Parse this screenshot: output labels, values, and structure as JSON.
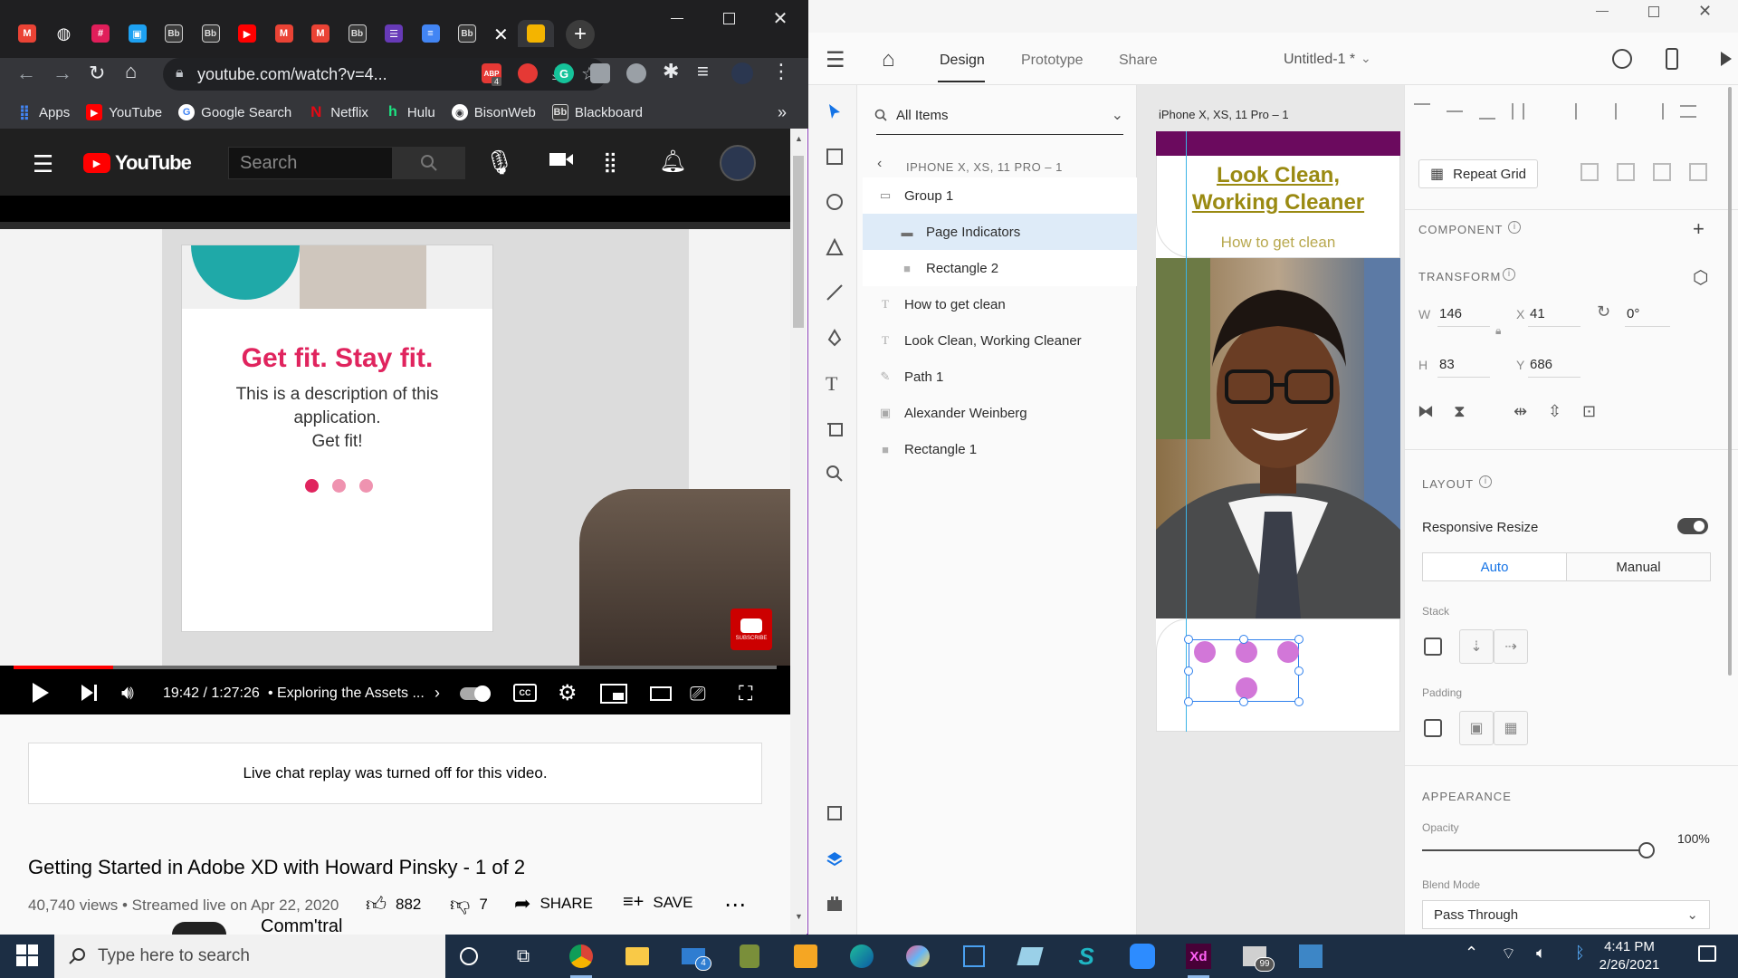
{
  "browser": {
    "tabs": [
      {
        "icon": "gmail-icon",
        "color": "#ea4335"
      },
      {
        "icon": "globe-icon",
        "color": "#ffffff"
      },
      {
        "icon": "slack-icon",
        "color": "#e01e5a"
      },
      {
        "icon": "twitter-icon",
        "color": "#1da1f2"
      },
      {
        "icon": "blackboard-icon",
        "color": "#cfcfcf"
      },
      {
        "icon": "blackboard-icon",
        "color": "#cfcfcf"
      },
      {
        "icon": "youtube-icon",
        "color": "#ff0000"
      },
      {
        "icon": "gmail-icon",
        "color": "#ea4335"
      },
      {
        "icon": "gmail-icon",
        "color": "#ea4335"
      },
      {
        "icon": "blackboard-icon",
        "color": "#cfcfcf"
      },
      {
        "icon": "forms-icon",
        "color": "#673ab7"
      },
      {
        "icon": "docs-icon",
        "color": "#4285f4"
      },
      {
        "icon": "blackboard-icon",
        "color": "#cfcfcf"
      }
    ],
    "active_tab_icon": "slides-icon",
    "url": "youtube.com/watch?v=4...",
    "extension_badge": "4",
    "bookmarks": [
      {
        "label": "Apps",
        "icon": "apps-grid-icon"
      },
      {
        "label": "YouTube",
        "icon": "youtube-icon"
      },
      {
        "label": "Google Search",
        "icon": "google-icon"
      },
      {
        "label": "Netflix",
        "icon": "netflix-icon"
      },
      {
        "label": "Hulu",
        "icon": "hulu-icon"
      },
      {
        "label": "BisonWeb",
        "icon": "bison-icon"
      },
      {
        "label": "Blackboard",
        "icon": "blackboard-icon"
      }
    ],
    "bookmarks_more": "»"
  },
  "youtube": {
    "logo_text": "YouTube",
    "search_placeholder": "Search",
    "video": {
      "title_card": "Get fit. Stay fit.",
      "description_lines": [
        "This is a description of this",
        "application.",
        "Get fit!"
      ],
      "subscribe_label": "SUBSCRIBE",
      "progress_fraction": 0.13,
      "time": "19:42 / 1:27:26",
      "chapter": "• Exploring the Assets ..."
    },
    "chat_notice": "Live chat replay was turned off for this video.",
    "title": "Getting Started in Adobe XD with Howard Pinsky - 1 of 2",
    "meta": "40,740 views • Streamed live on Apr 22, 2020",
    "likes": "882",
    "dislikes": "7",
    "share_label": "SHARE",
    "save_label": "SAVE",
    "next_peek": "Comm'tral"
  },
  "xd": {
    "tabs": {
      "design": "Design",
      "prototype": "Prototype",
      "share": "Share"
    },
    "doc_title": "Untitled-1 *",
    "layers": {
      "filter": "All Items",
      "artboard_crumb": "IPHONE X, XS, 11 PRO – 1",
      "items": [
        {
          "label": "Group 1",
          "icon": "folder-icon"
        },
        {
          "label": "Page Indicators",
          "icon": "folder-icon"
        },
        {
          "label": "Rectangle 2",
          "icon": "rectangle-icon"
        },
        {
          "label": "How to get clean",
          "icon": "text-icon"
        },
        {
          "label": "Look Clean,  Working Cleaner",
          "icon": "text-icon"
        },
        {
          "label": "Path 1",
          "icon": "path-icon"
        },
        {
          "label": "Alexander Weinberg",
          "icon": "image-icon"
        },
        {
          "label": "Rectangle 1",
          "icon": "rectangle-icon"
        }
      ]
    },
    "canvas": {
      "artboard_name": "iPhone X, XS, 11 Pro – 1",
      "headline_1": "Look Clean,",
      "headline_2": "Working Cleaner",
      "subhead": "How to get clean",
      "accent_color": "#6b0a5e",
      "headline_color": "#9a8a12",
      "dot_color": "#d277d8",
      "selection_color": "#2f80ed"
    },
    "props": {
      "repeat_grid": "Repeat Grid",
      "component": "COMPONENT",
      "transform": "TRANSFORM",
      "w_label": "W",
      "w": "146",
      "x_label": "X",
      "x": "41",
      "rotation": "0°",
      "h_label": "H",
      "h": "83",
      "y_label": "Y",
      "y": "686",
      "layout": "LAYOUT",
      "responsive_resize": "Responsive Resize",
      "responsive_on": true,
      "auto": "Auto",
      "manual": "Manual",
      "stack": "Stack",
      "padding": "Padding",
      "appearance": "APPEARANCE",
      "opacity_label": "Opacity",
      "opacity": "100%",
      "blend_label": "Blend Mode",
      "blend": "Pass Through"
    }
  },
  "taskbar": {
    "search_placeholder": "Type here to search",
    "mail_badge": "4",
    "notif_badge": "99",
    "time": "4:41 PM",
    "date": "2/26/2021"
  }
}
